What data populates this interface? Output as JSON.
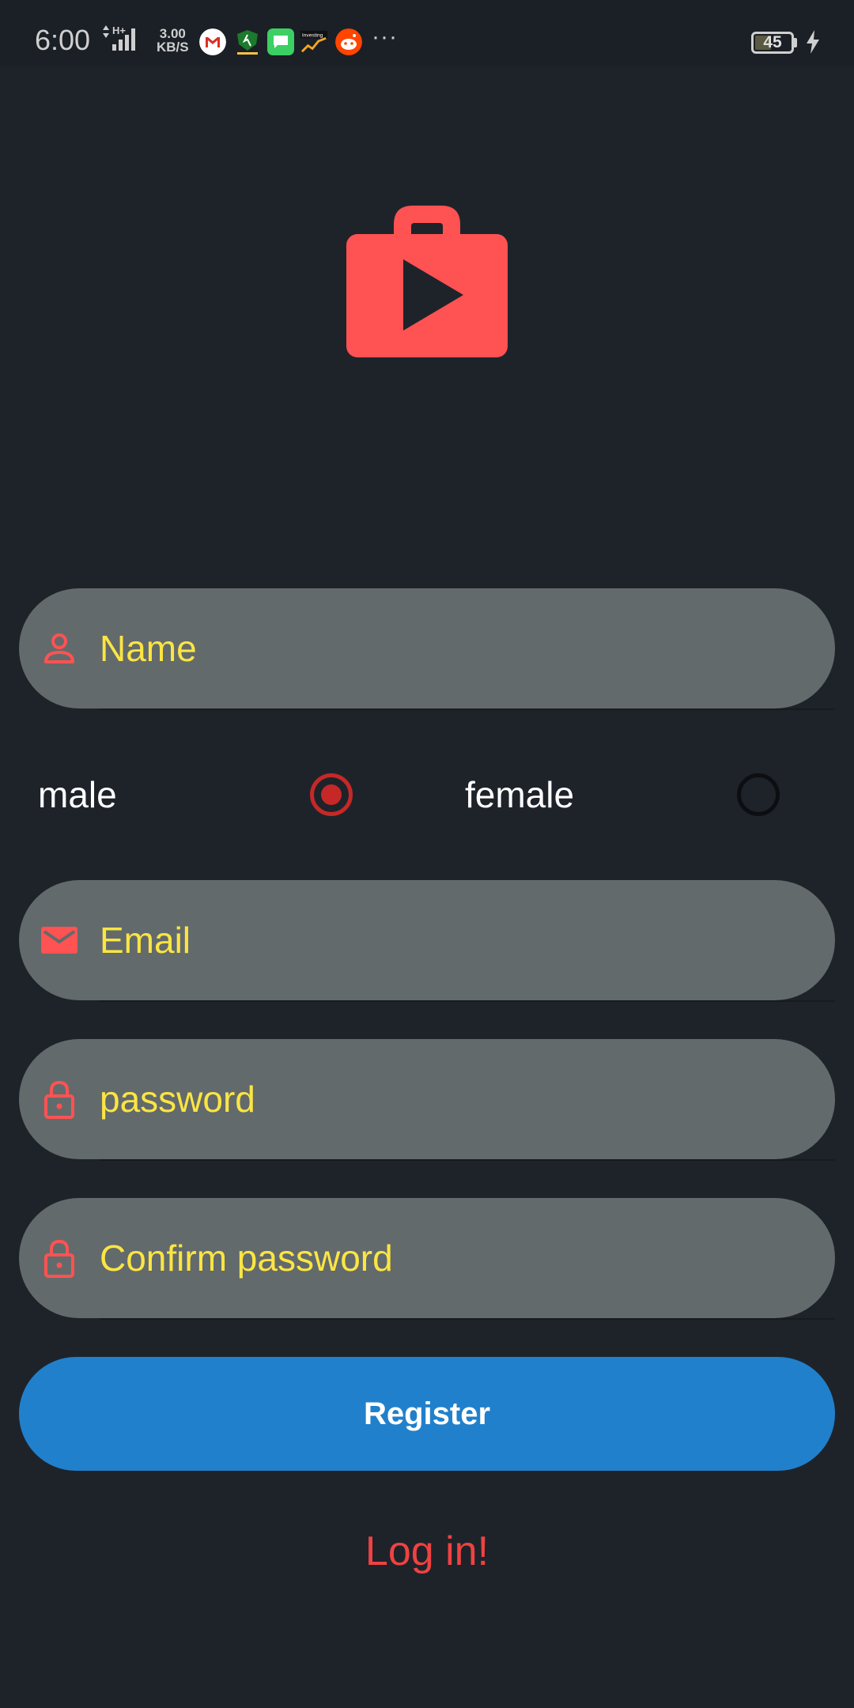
{
  "status_bar": {
    "time": "6:00",
    "network_type": "H+",
    "speed_value": "3.00",
    "speed_unit": "KB/S",
    "battery_level": "45",
    "battery_fill_fraction": 0.45,
    "app_icons": [
      "gmail-icon",
      "shield-app-icon",
      "messages-icon",
      "investing-icon",
      "reddit-icon"
    ],
    "more_indicator": "···"
  },
  "logo": {
    "icon": "shopping-bag-play-icon",
    "color": "#ff5252"
  },
  "form": {
    "name": {
      "placeholder": "Name",
      "icon": "person-icon"
    },
    "gender": {
      "options": [
        {
          "label": "male",
          "checked": true
        },
        {
          "label": "female",
          "checked": false
        }
      ]
    },
    "email": {
      "placeholder": "Email",
      "icon": "mail-icon"
    },
    "password": {
      "placeholder": "password",
      "icon": "lock-icon"
    },
    "confirm_password": {
      "placeholder": "Confirm password",
      "icon": "lock-icon"
    }
  },
  "actions": {
    "register_label": "Register",
    "login_label": "Log in!"
  },
  "colors": {
    "background": "#1e232a",
    "field_background": "#636a6b",
    "placeholder_text": "#fbe543",
    "icon_accent": "#ff5252",
    "radio_checked": "#c62828",
    "register_button": "#2180cb",
    "login_link": "#ef4242"
  }
}
